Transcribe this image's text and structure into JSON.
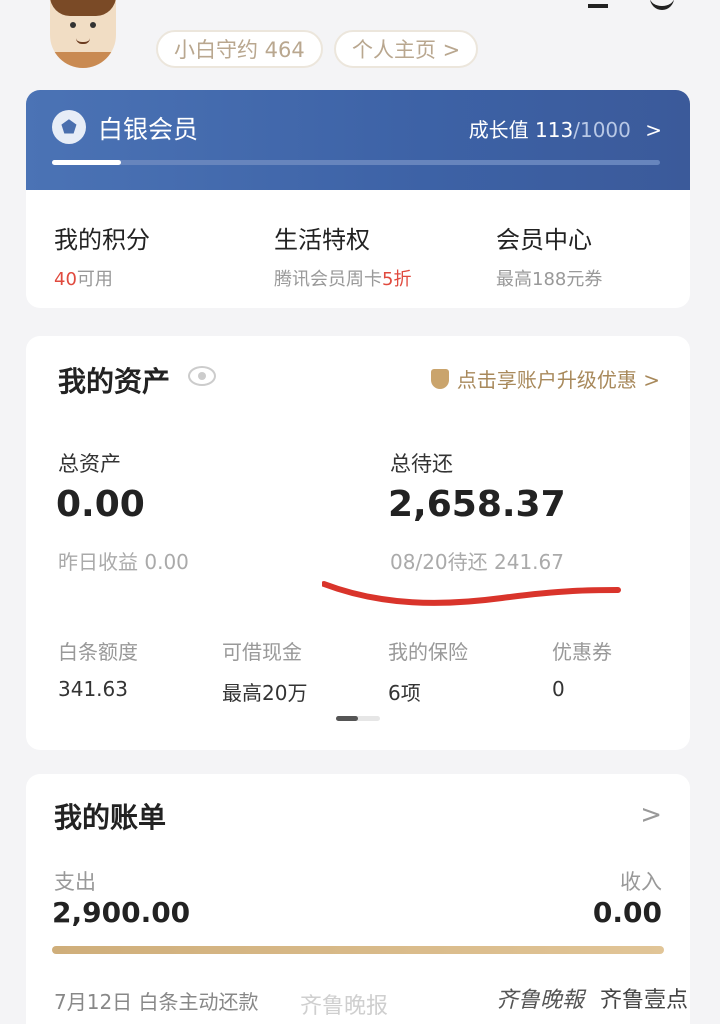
{
  "header": {
    "level_label": "小白守约 464",
    "home_link": "个人主页 >"
  },
  "membership": {
    "tier_label": "白银会员",
    "growth_label": "成长值",
    "growth_current": "113",
    "growth_max": "/1000",
    "growth_progress": 0.113,
    "chevron": ">",
    "perks": [
      {
        "title": "我的积分",
        "sub_prefix": "",
        "sub_highlight": "40",
        "sub_suffix": "可用"
      },
      {
        "title": "生活特权",
        "sub_prefix": "腾讯会员周卡",
        "sub_highlight": "5折",
        "sub_suffix": ""
      },
      {
        "title": "会员中心",
        "sub_prefix": "最高188元券",
        "sub_highlight": "",
        "sub_suffix": ""
      }
    ]
  },
  "assets": {
    "title": "我的资产",
    "upgrade_link": "点击享账户升级优惠 >",
    "total_assets_label": "总资产",
    "total_assets_value": "0.00",
    "yesterday_income": "昨日收益 0.00",
    "total_due_label": "总待还",
    "total_due_value": "2,658.37",
    "next_due": "08/20待还 241.67",
    "items": [
      {
        "label": "白条额度",
        "value": "341.63"
      },
      {
        "label": "可借现金",
        "value": "最高20万"
      },
      {
        "label": "我的保险",
        "value": "6项"
      },
      {
        "label": "优惠券",
        "value": "0"
      }
    ]
  },
  "bill": {
    "title": "我的账单",
    "chevron": ">",
    "expense_label": "支出",
    "expense_value": "2,900.00",
    "income_label": "收入",
    "income_value": "0.00",
    "record": "7月12日  白条主动还款"
  },
  "watermarks": {
    "weibo": "齐鲁晚报",
    "paper": "齐鲁晚報",
    "app": "齐鲁壹点"
  },
  "colors": {
    "vip_band": "#3d62a6",
    "highlight_red": "#e04a3e",
    "gold": "#a8895b",
    "annotation_red": "#d9342b"
  }
}
